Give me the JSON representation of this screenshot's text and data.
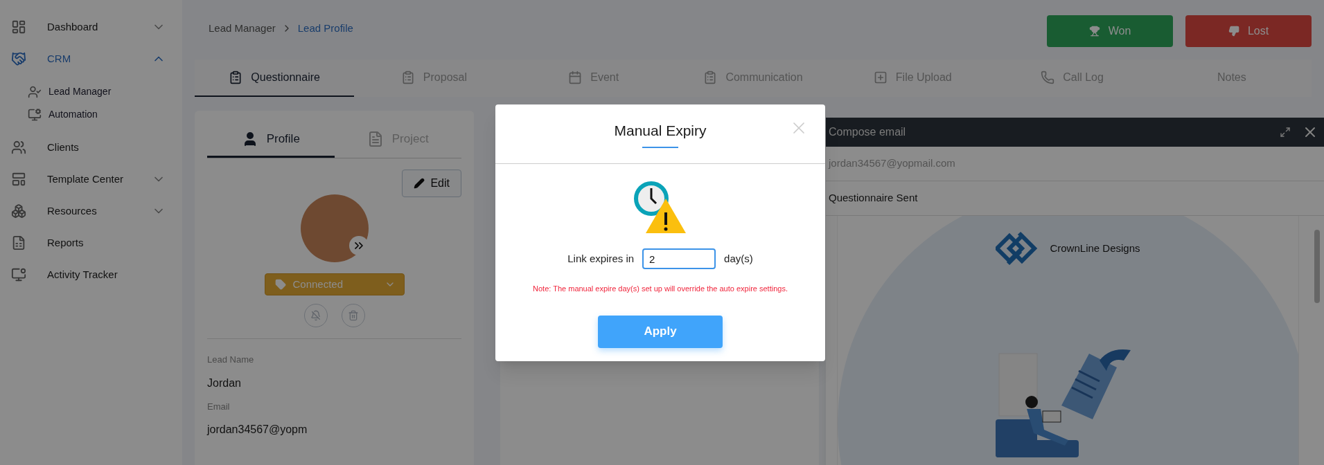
{
  "sidebar": {
    "items": [
      {
        "label": "Dashboard",
        "kind": "group",
        "expanded": false,
        "selected": false
      },
      {
        "label": "CRM",
        "kind": "group",
        "expanded": true,
        "selected": true,
        "children": [
          {
            "label": "Lead Manager"
          },
          {
            "label": "Automation"
          }
        ]
      },
      {
        "label": "Clients",
        "kind": "link",
        "selected": false
      },
      {
        "label": "Template Center",
        "kind": "group",
        "expanded": false,
        "selected": false
      },
      {
        "label": "Resources",
        "kind": "group",
        "expanded": false,
        "selected": false
      },
      {
        "label": "Reports",
        "kind": "link",
        "selected": false
      },
      {
        "label": "Activity Tracker",
        "kind": "link",
        "selected": false
      }
    ]
  },
  "breadcrumb": [
    "Lead Manager",
    "Lead Profile"
  ],
  "actions": [
    {
      "label": "Won",
      "kind": "won"
    },
    {
      "label": "Lost",
      "kind": "lost"
    }
  ],
  "tabs": [
    {
      "label": "Questionnaire",
      "selected": true
    },
    {
      "label": "Proposal",
      "selected": false
    },
    {
      "label": "Event",
      "selected": false
    },
    {
      "label": "Communication",
      "selected": false
    },
    {
      "label": "File Upload",
      "selected": false
    },
    {
      "label": "Call Log",
      "selected": false
    },
    {
      "label": "Notes",
      "selected": false
    }
  ],
  "profile": {
    "tabs": [
      {
        "label": "Profile",
        "selected": true
      },
      {
        "label": "Project",
        "selected": false
      }
    ],
    "edit_button": "Edit",
    "status": "Connected",
    "fields": [
      {
        "label": "Lead Name",
        "value": "Jordan"
      },
      {
        "label": "Email",
        "value": "jordan34567@yopm"
      }
    ]
  },
  "compose": {
    "title": "Compose email",
    "to": "jordan34567@yopmail.com",
    "subject": "Questionnaire Sent",
    "brand": "CrownLine Designs"
  },
  "modal": {
    "title": "Manual Expiry",
    "prefix": "Link expires in",
    "value": "2",
    "suffix": "day(s)",
    "note": "Note: The manual expire day(s) set up will override the auto expire settings.",
    "apply": "Apply"
  }
}
